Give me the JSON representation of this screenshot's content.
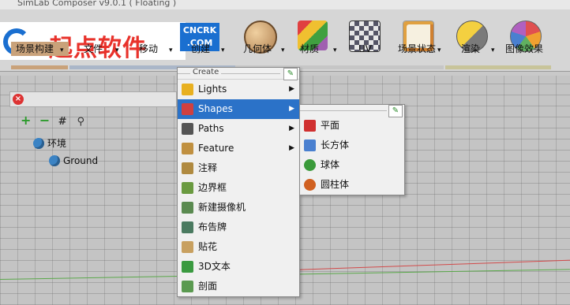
{
  "window": {
    "title": "SimLab Composer v9.0.1 ( Floating )"
  },
  "logo": {
    "text": "起点软件",
    "badge_line1": "CNCRK",
    "badge_line2": ".COM"
  },
  "tabs": [
    {
      "label": "场景构建",
      "dropdown": "▾"
    },
    {
      "label": "文件",
      "dropdown": "▾"
    },
    {
      "label": "移动",
      "dropdown": "▾"
    },
    {
      "label": "创建",
      "dropdown": "▾"
    },
    {
      "label": "几何体",
      "dropdown": "▾"
    },
    {
      "label": "材质",
      "dropdown": "▾"
    },
    {
      "label": "UV",
      "dropdown": ""
    },
    {
      "label": "场景状态",
      "dropdown": "▾"
    },
    {
      "label": "渲染",
      "dropdown": "▾"
    },
    {
      "label": "图像效果",
      "dropdown": ""
    }
  ],
  "toolbar_icons": [
    {
      "name": "geometry-sphere-icon",
      "color": "#c8a070"
    },
    {
      "name": "materials-icon",
      "color": "#a060b0"
    },
    {
      "name": "uv-checker-icon",
      "color": "#6a8090"
    },
    {
      "name": "scene-state-icon",
      "color": "#d08a40"
    },
    {
      "name": "render-icon",
      "color": "#e0b030"
    },
    {
      "name": "image-effects-icon",
      "color": "#e05050"
    }
  ],
  "scene_tree": {
    "root": "环境",
    "child": "Ground"
  },
  "create_menu": {
    "header": "Create",
    "items": [
      {
        "label": "Lights",
        "icon": "lights-icon",
        "color": "#e8b020",
        "submenu": true
      },
      {
        "label": "Shapes",
        "icon": "shapes-icon",
        "color": "#d04040",
        "submenu": true,
        "active": true
      },
      {
        "label": "Paths",
        "icon": "paths-icon",
        "color": "#555555",
        "submenu": true
      },
      {
        "label": "Feature",
        "icon": "feature-icon",
        "color": "#c09040",
        "submenu": true
      },
      {
        "label": "注释",
        "icon": "annotation-icon",
        "color": "#b08a40",
        "submenu": false
      },
      {
        "label": "边界框",
        "icon": "bounding-box-icon",
        "color": "#6a9a40",
        "submenu": false
      },
      {
        "label": "新建摄像机",
        "icon": "camera-icon",
        "color": "#5a8a50",
        "submenu": false
      },
      {
        "label": "布告牌",
        "icon": "billboard-icon",
        "color": "#4a7a60",
        "submenu": false
      },
      {
        "label": "贴花",
        "icon": "decal-icon",
        "color": "#c8a060",
        "submenu": false
      },
      {
        "label": "3D文本",
        "icon": "text-3d-icon",
        "color": "#3a9a40",
        "submenu": false
      },
      {
        "label": "剖面",
        "icon": "section-icon",
        "color": "#5a9a50",
        "submenu": false
      }
    ]
  },
  "shapes_menu": {
    "items": [
      {
        "label": "平面",
        "icon": "plane-icon",
        "color": "#d03030"
      },
      {
        "label": "长方体",
        "icon": "box-icon",
        "color": "#4a80d0"
      },
      {
        "label": "球体",
        "icon": "sphere-icon",
        "color": "#3a9a3a"
      },
      {
        "label": "圆柱体",
        "icon": "cylinder-icon",
        "color": "#d06020"
      }
    ]
  },
  "colors": {
    "accent": "#2b72c8",
    "tab_active": "#c9a27a"
  }
}
